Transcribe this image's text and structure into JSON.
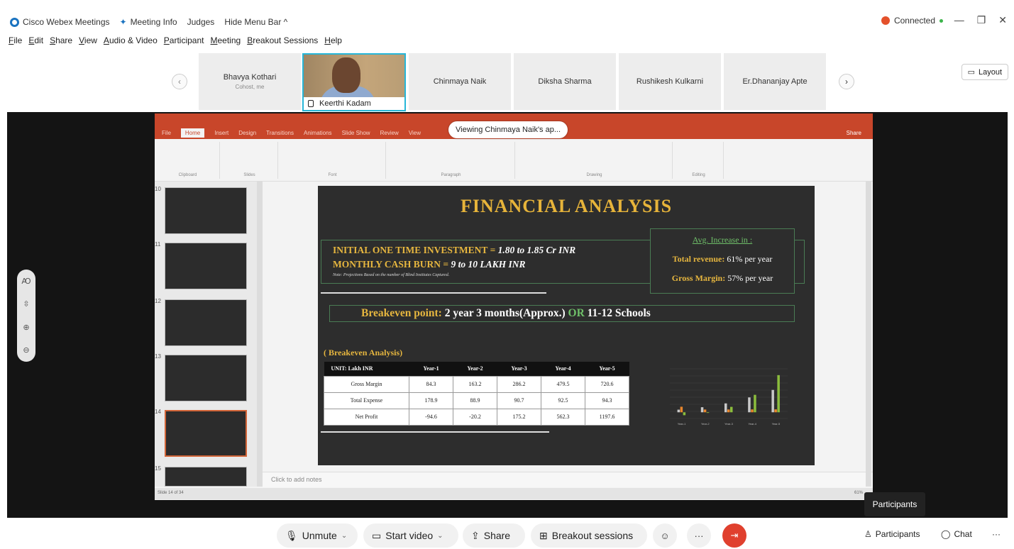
{
  "topbar": {
    "app_name": "Cisco Webex Meetings",
    "meeting_info": "Meeting Info",
    "judges": "Judges",
    "hide_menu": "Hide Menu Bar ^",
    "connected": "Connected"
  },
  "menu": [
    "File",
    "Edit",
    "Share",
    "View",
    "Audio & Video",
    "Participant",
    "Meeting",
    "Breakout Sessions",
    "Help"
  ],
  "participants_strip": {
    "tiles": [
      {
        "name": "Bhavya Kothari",
        "sub": "Cohost, me"
      },
      {
        "name": "Chinmaya Naik",
        "sub": ""
      },
      {
        "name": "Diksha Sharma",
        "sub": ""
      },
      {
        "name": "Rushikesh Kulkarni",
        "sub": ""
      },
      {
        "name": "Er.Dhananjay Apte",
        "sub": ""
      }
    ],
    "active_speaker": "Keerthi Kadam",
    "layout_label": "Layout"
  },
  "viewing_banner": "Viewing Chinmaya Naik's ap...",
  "ppt": {
    "tabs": [
      "File",
      "Home",
      "Insert",
      "Design",
      "Transitions",
      "Animations",
      "Slide Show",
      "Review",
      "View"
    ],
    "share_label": "Share",
    "ribbon_groups": [
      "Clipboard",
      "Slides",
      "Font",
      "Paragraph",
      "Drawing",
      "Editing"
    ],
    "thumb_numbers": [
      "10",
      "11",
      "12",
      "13",
      "14",
      "15"
    ],
    "notes_placeholder": "Click to add notes",
    "status_left": "Slide 14 of 34",
    "status_zoom": "61%"
  },
  "slide": {
    "title": "FINANCIAL ANALYSIS",
    "line1_label": "INITIAL ONE TIME INVESTMENT = ",
    "line1_value": "1.80 to 1.85 Cr INR",
    "line2_label": "MONTHLY CASH BURN = ",
    "line2_value": "9 to 10 LAKH INR",
    "note": "Note: Projections Based on the number of Blind Institutes Captured.",
    "avg_heading": "Avg. Increase in :",
    "avg_rev_label": "Total revenue:",
    "avg_rev_value": " 61% per year",
    "avg_gm_label": "Gross Margin:",
    "avg_gm_value": " 57% per year",
    "breakeven_label": "Breakeven point: ",
    "breakeven_value": "2 year 3 months(Approx.) ",
    "breakeven_or": "OR",
    "breakeven_schools": " 11-12 Schools",
    "analysis_label": "( Breakeven Analysis)",
    "table": {
      "headers": [
        "UNIT: Lakh INR",
        "Year-1",
        "Year-2",
        "Year-3",
        "Year-4",
        "Year-5"
      ],
      "rows": [
        [
          "Gross Margin",
          "84.3",
          "163.2",
          "286.2",
          "479.5",
          "720.6"
        ],
        [
          "Total Expense",
          "178.9",
          "88.9",
          "90.7",
          "92.5",
          "94.3"
        ],
        [
          "Net Profit",
          "-94.6",
          "-20.2",
          "175.2",
          "562.3",
          "1197.6"
        ]
      ]
    }
  },
  "chart_data": {
    "type": "bar",
    "categories": [
      "Year-1",
      "Year-2",
      "Year-3",
      "Year-4",
      "Year-5"
    ],
    "series": [
      {
        "name": "",
        "values": [
          84.3,
          163.2,
          286.2,
          479.5,
          720.6
        ],
        "color": "#c9c9c9"
      },
      {
        "name": "",
        "values": [
          178.9,
          88.9,
          90.7,
          92.5,
          94.3
        ],
        "color": "#e8862c"
      },
      {
        "name": "",
        "values": [
          -94.6,
          -20.2,
          175.2,
          562.3,
          1197.6
        ],
        "color": "#8bbd3c"
      }
    ],
    "ylim": [
      -200,
      1400
    ]
  },
  "bottom": {
    "unmute": "Unmute",
    "start_video": "Start video",
    "share": "Share",
    "breakout": "Breakout sessions",
    "participants": "Participants",
    "chat": "Chat",
    "tooltip": "Participants"
  },
  "side_tools": [
    "Ai",
    "fit",
    "zoom-in",
    "zoom-out"
  ]
}
